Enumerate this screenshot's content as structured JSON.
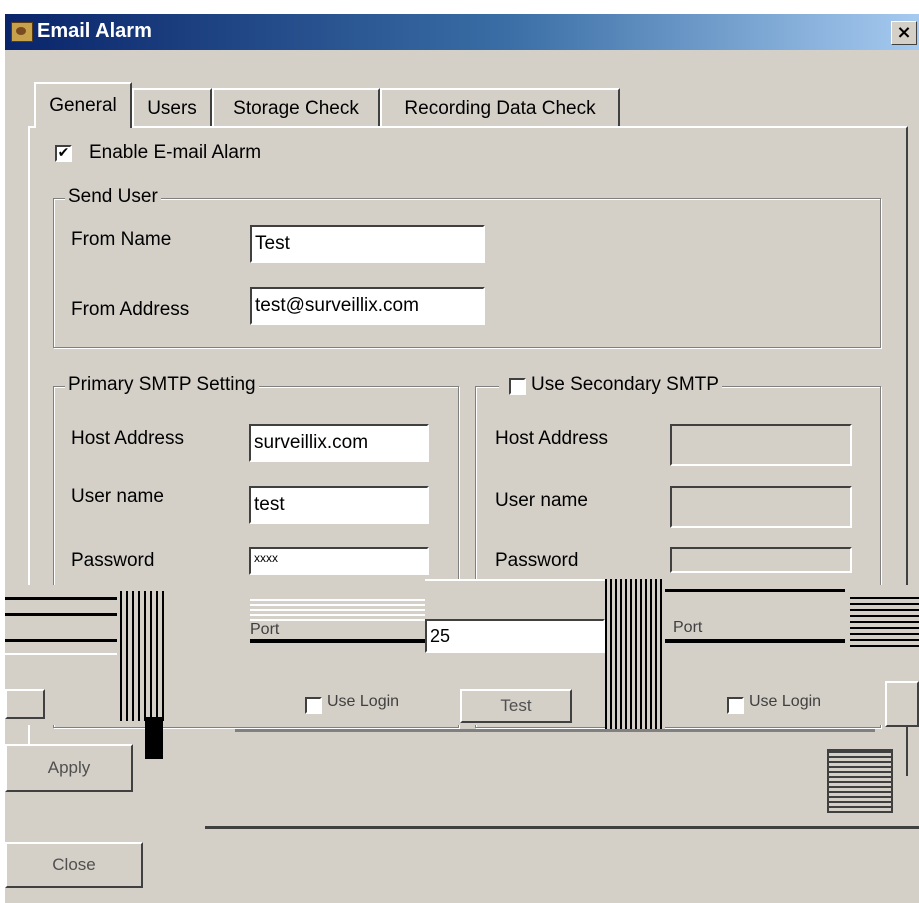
{
  "window": {
    "title": "Email Alarm",
    "close_symbol": "×"
  },
  "tabs": [
    {
      "label": "General",
      "active": true
    },
    {
      "label": "Users",
      "active": false
    },
    {
      "label": "Storage Check",
      "active": false
    },
    {
      "label": "Recording Data Check",
      "active": false
    }
  ],
  "general": {
    "enable_checkbox": {
      "label": "Enable E-mail Alarm",
      "checked": true,
      "mark": "✔"
    },
    "send_user": {
      "legend": "Send User",
      "from_name_label": "From Name",
      "from_name_value": "Test",
      "from_address_label": "From Address",
      "from_address_value": "test@surveillix.com"
    },
    "primary_smtp": {
      "legend": "Primary SMTP Setting",
      "host_label": "Host Address",
      "host_value": "surveillix.com",
      "user_label": "User name",
      "user_value": "test",
      "password_label": "Password",
      "password_value": "xxxx",
      "port_label": "Port",
      "port_value": "25",
      "use_login_label": "Use Login",
      "test_label": "Test"
    },
    "secondary_smtp": {
      "legend": "Use Secondary SMTP",
      "checked": false,
      "host_label": "Host Address",
      "user_label": "User name",
      "password_label": "Password",
      "port_label": "Port",
      "use_login_label": "Use Login"
    }
  },
  "footer": {
    "apply_label": "Apply",
    "close_label": "Close"
  }
}
